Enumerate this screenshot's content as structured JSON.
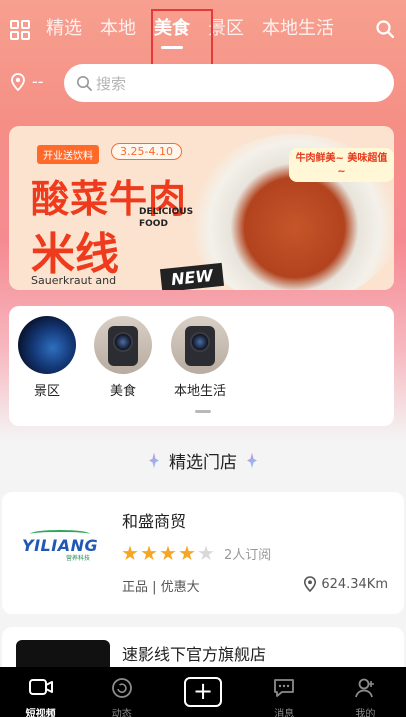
{
  "nav": {
    "tabs": [
      "精选",
      "本地",
      "美食",
      "景区",
      "本地生活"
    ],
    "active_tab": "美食"
  },
  "location": {
    "text": "--"
  },
  "search": {
    "placeholder": "搜索"
  },
  "banner": {
    "tag": "开业送饮料",
    "date": "3.25-4.10",
    "title_line1": "酸菜牛肉",
    "title_line2": "米线",
    "english_title": "DELICIOUS FOOD",
    "english_sub": "Sauerkraut and",
    "new_label": "NEW",
    "bubble_text": "牛肉鲜美~ 美味超值~"
  },
  "categories": [
    {
      "label": "景区",
      "icon": "earth-image"
    },
    {
      "label": "美食",
      "icon": "projector-image"
    },
    {
      "label": "本地生活",
      "icon": "projector-image"
    }
  ],
  "section": {
    "title": "精选门店"
  },
  "stores": [
    {
      "name": "和盛商贸",
      "logo_text": "YILIANG",
      "rating": 4,
      "rating_max": 5,
      "subscribers": "2人订阅",
      "tags": "正品 | 优惠大",
      "distance": "624.34Km"
    },
    {
      "name": "速影线下官方旗舰店"
    }
  ],
  "bottom_nav": [
    {
      "label": "短视频",
      "icon": "video-icon",
      "active": true
    },
    {
      "label": "动态",
      "icon": "refresh-circle-icon",
      "active": false
    },
    {
      "label": "",
      "icon": "plus-icon",
      "active": false
    },
    {
      "label": "消息",
      "icon": "message-icon",
      "active": false
    },
    {
      "label": "我的",
      "icon": "user-icon",
      "active": false
    }
  ],
  "colors": {
    "accent": "#f5a623",
    "highlight_box": "#e63a3a",
    "header_gradient": "#f58f86"
  }
}
